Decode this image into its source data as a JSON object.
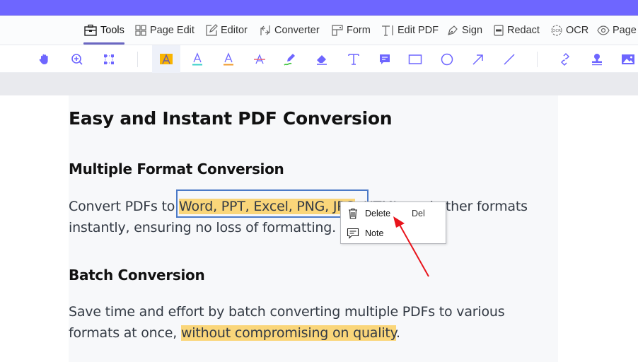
{
  "menubar": {
    "items": [
      {
        "label": "Tools",
        "icon": "toolbox-icon",
        "active": true
      },
      {
        "label": "Page Edit",
        "icon": "grid-icon"
      },
      {
        "label": "Editor",
        "icon": "edit-icon"
      },
      {
        "label": "Converter",
        "icon": "convert-icon"
      },
      {
        "label": "Form",
        "icon": "form-icon"
      },
      {
        "label": "Edit PDF",
        "icon": "text-cursor-icon"
      },
      {
        "label": "Sign",
        "icon": "pen-nib-icon"
      },
      {
        "label": "Redact",
        "icon": "redact-icon"
      },
      {
        "label": "OCR",
        "icon": "ocr-icon"
      },
      {
        "label": "Page",
        "icon": "eye-icon"
      }
    ]
  },
  "toolbar": {
    "tools": [
      "hand-icon",
      "zoom-in-icon",
      "marquee-select-icon",
      "highlight-icon",
      "underline-icon",
      "squiggly-underline-icon",
      "strikethrough-icon",
      "pencil-icon",
      "eraser-icon",
      "text-icon",
      "comment-icon",
      "rectangle-icon",
      "circle-icon",
      "arrow-icon",
      "line-icon",
      "link-icon",
      "stamp-icon",
      "image-icon"
    ],
    "active_tool": "highlight-icon",
    "colors": {
      "accent": "#6e66ff",
      "highlight": "#f9b400",
      "underline": "#3ad1c8",
      "squiggly": "#f09a2a",
      "strike": "#e8566a",
      "pencil_stroke": "#3ec43a"
    }
  },
  "document": {
    "title": "Easy and Instant PDF Conversion",
    "section1": {
      "heading": "Multiple Format Conversion",
      "line1_pre": "Convert PDFs to ",
      "line1_hl": "Word, PPT, Excel, PNG, JPG",
      "line1_post": ", HTML, and other formats",
      "line2": "instantly, ensuring no loss of formatting."
    },
    "section2": {
      "heading": "Batch Conversion",
      "line1": "Save time and effort by batch converting multiple PDFs to various",
      "line2_pre": "formats at once, ",
      "line2_hl": "without compromising on quality",
      "line2_post": "."
    },
    "highlight_color": "#fad67a"
  },
  "context_menu": {
    "items": [
      {
        "label": "Delete",
        "shortcut": "Del",
        "icon": "trash-icon"
      },
      {
        "label": "Note",
        "shortcut": "",
        "icon": "note-icon"
      }
    ]
  },
  "annotation_arrow_color": "#e8141c"
}
